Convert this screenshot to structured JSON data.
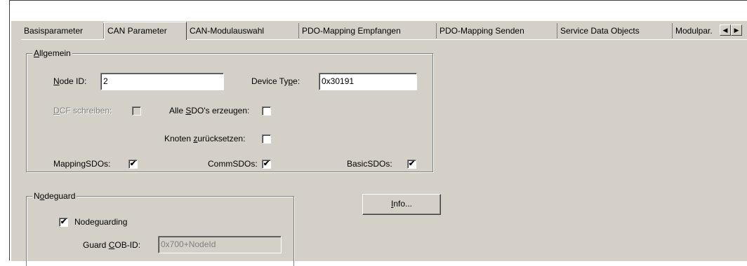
{
  "tabs": [
    {
      "label": "Basisparameter"
    },
    {
      "label": "CAN Parameter"
    },
    {
      "label": "CAN-Modulauswahl"
    },
    {
      "label": "PDO-Mapping Empfangen"
    },
    {
      "label": "PDO-Mapping Senden"
    },
    {
      "label": "Service Data Objects"
    },
    {
      "label": "Modulpar."
    }
  ],
  "active_tab": "CAN Parameter",
  "allgemein": {
    "title_pre": "",
    "title_ul": "A",
    "title_post": "llgemein",
    "node_id": {
      "pre": "",
      "ul": "N",
      "post": "ode ID:",
      "value": "2"
    },
    "device_type": {
      "pre": "Device Ty",
      "ul": "p",
      "post": "e:",
      "value": "0x30191"
    },
    "dcf": {
      "pre": "",
      "ul": "D",
      "post": "CF schreiben:",
      "checked": false
    },
    "alle_sdo": {
      "pre": "Alle ",
      "ul": "S",
      "post": "DO's erzeugen:",
      "checked": false
    },
    "knoten": {
      "pre": "Knoten ",
      "ul": "z",
      "post": "urücksetzen:",
      "checked": false
    },
    "mapping": {
      "label": "MappingSDOs:",
      "checked": true
    },
    "comm": {
      "label": "CommSDOs:",
      "checked": true
    },
    "basic": {
      "label": "BasicSDOs:",
      "checked": true
    }
  },
  "nodeguard": {
    "title_pre": "N",
    "title_ul": "o",
    "title_post": "deguard",
    "nodeguarding": {
      "label": "Nodeguarding",
      "checked": true
    },
    "guard_cob": {
      "pre": "Guard ",
      "ul": "C",
      "post": "OB-ID:",
      "placeholder": "0x700+NodeId"
    }
  },
  "info_button": {
    "ul": "I",
    "post": "nfo..."
  },
  "check_mark": "✔",
  "scroll_left": "◀",
  "scroll_right": "▶"
}
